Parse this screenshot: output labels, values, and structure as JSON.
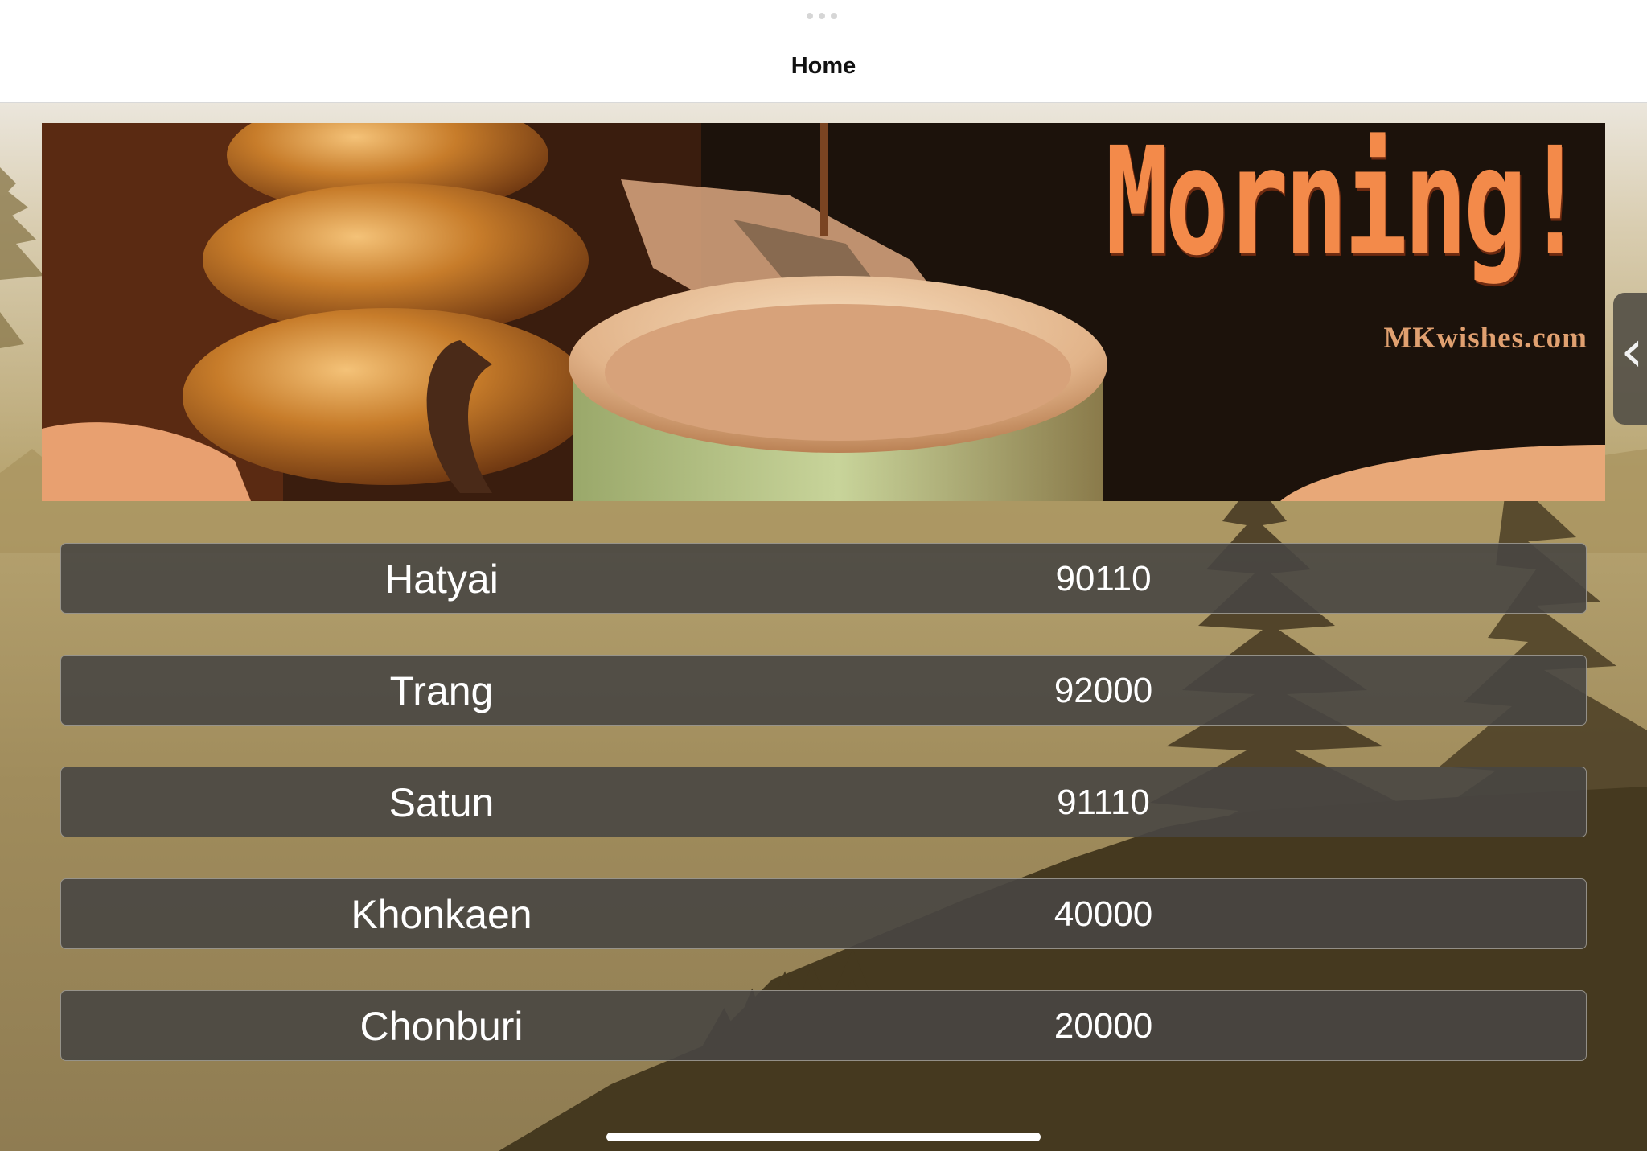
{
  "nav": {
    "title": "Home"
  },
  "banner": {
    "headline": "Morning!",
    "site": "MKwishes.com"
  },
  "locations": [
    {
      "name": "Hatyai",
      "code": "90110"
    },
    {
      "name": "Trang",
      "code": "92000"
    },
    {
      "name": "Satun",
      "code": "91110"
    },
    {
      "name": "Khonkaen",
      "code": "40000"
    },
    {
      "name": "Chonburi",
      "code": "20000"
    }
  ],
  "side_panel": {
    "icon": "chevron-left-icon",
    "glyph": "‹"
  },
  "colors": {
    "row_bg": "#4a4844",
    "headline": "#f38a4a",
    "banner_bg": "#1c120b",
    "scene_sky": "#b6a57a",
    "trees": "#4a3d25"
  }
}
